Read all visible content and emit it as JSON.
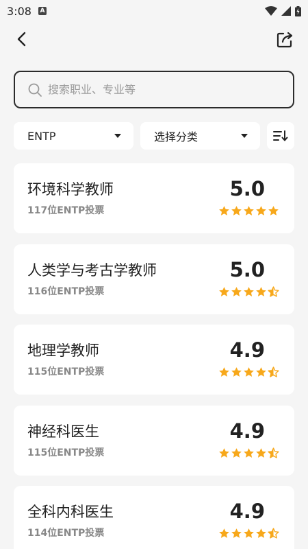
{
  "status": {
    "time": "3:08"
  },
  "search": {
    "placeholder": "搜索职业、专业等"
  },
  "filters": {
    "type_value": "ENTP",
    "category_value": "选择分类"
  },
  "colors": {
    "star": "#F7A81B",
    "text": "#222222",
    "muted": "#888888"
  },
  "icons": [
    "back-arrow-icon",
    "share-icon",
    "search-icon",
    "caret-down-icon",
    "sort-icon",
    "star-icon",
    "star-half-icon"
  ],
  "items": [
    {
      "title": "环境科学教师",
      "votes": "117位ENTP投票",
      "score": "5.0",
      "rating": 5
    },
    {
      "title": "人类学与考古学教师",
      "votes": "116位ENTP投票",
      "score": "5.0",
      "rating": 4.5
    },
    {
      "title": "地理学教师",
      "votes": "115位ENTP投票",
      "score": "4.9",
      "rating": 4.5
    },
    {
      "title": "神经科医生",
      "votes": "115位ENTP投票",
      "score": "4.9",
      "rating": 4.5
    },
    {
      "title": "全科内科医生",
      "votes": "114位ENTP投票",
      "score": "4.9",
      "rating": 4.5
    }
  ]
}
